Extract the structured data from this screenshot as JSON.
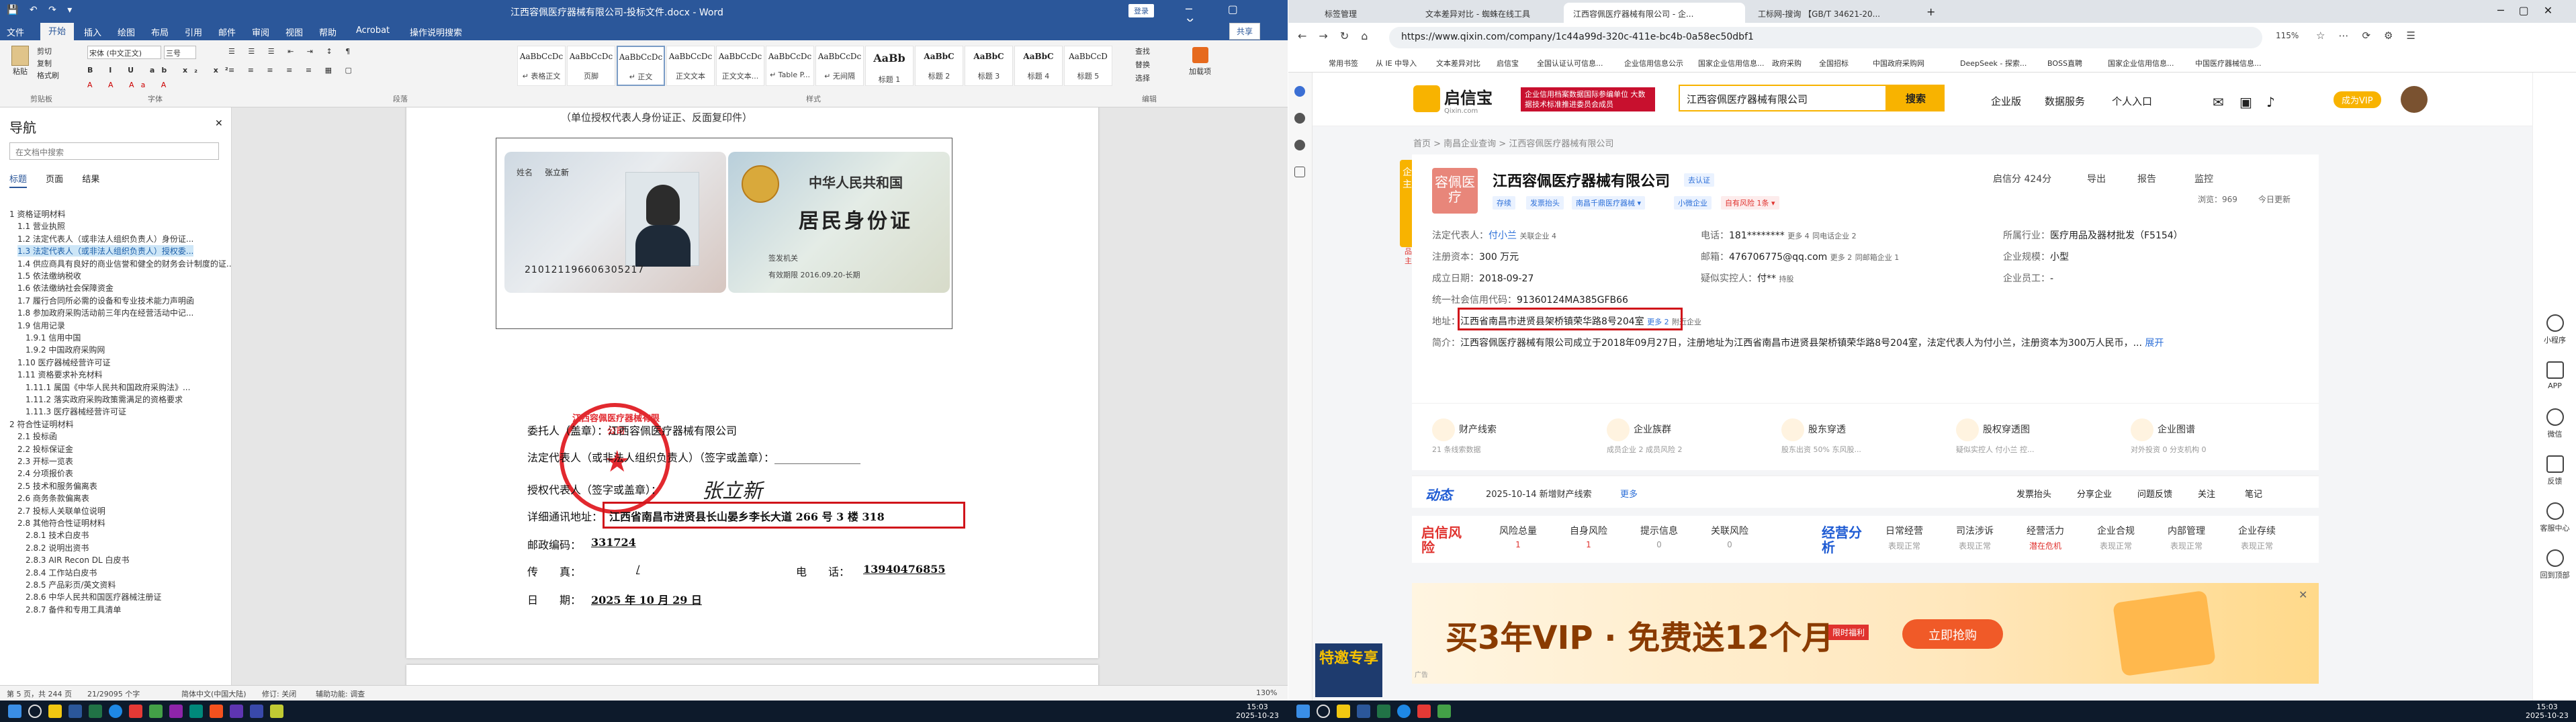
{
  "word": {
    "title": "江西容佩医疗器械有限公司-投标文件.docx - Word",
    "account": "登录",
    "share": "共享",
    "tabs": [
      "文件",
      "开始",
      "插入",
      "绘图",
      "布局",
      "引用",
      "邮件",
      "审阅",
      "视图",
      "帮助",
      "Acrobat",
      "操作说明搜索"
    ],
    "clipboard": {
      "paste": "粘贴",
      "cut": "剪切",
      "copy": "复制",
      "painter": "格式刷",
      "group": "剪贴板"
    },
    "font": {
      "name": "宋体 (中文正文)",
      "size": "三号",
      "group": "字体"
    },
    "paragraph_group": "段落",
    "styles": [
      {
        "sample": "AaBbCcDc",
        "name": "↵ 表格正文"
      },
      {
        "sample": "AaBbCcDc",
        "name": "页脚"
      },
      {
        "sample": "AaBbCcDc",
        "name": "↵ 正文"
      },
      {
        "sample": "AaBbCcDc",
        "name": "正文文本"
      },
      {
        "sample": "AaBbCcDc",
        "name": "正文文本..."
      },
      {
        "sample": "AaBbCcDc",
        "name": "↵ Table P..."
      },
      {
        "sample": "AaBbCcDc",
        "name": "↵ 无间隔"
      },
      {
        "sample": "AaBb",
        "name": "标题 1"
      },
      {
        "sample": "AaBbC",
        "name": "标题 2"
      },
      {
        "sample": "AaBbC",
        "name": "标题 3"
      },
      {
        "sample": "AaBbC",
        "name": "标题 4"
      },
      {
        "sample": "AaBbCcD",
        "name": "标题 5"
      }
    ],
    "styles_group": "样式",
    "editing": {
      "find": "查找",
      "replace": "替换",
      "select": "选择",
      "group": "编辑"
    },
    "addin": "加载项",
    "nav": {
      "title": "导航",
      "search_placeholder": "在文档中搜索",
      "tabs": [
        "标题",
        "页面",
        "结果"
      ],
      "items": [
        "1 资格证明材料",
        "1.1 营业执照",
        "1.2 法定代表人（或非法人组织负责人）身份证...",
        "1.3 法定代表人（或非法人组织负责人）授权委...",
        "1.4 供应商具有良好的商业信誉和健全的财务会计制度的证...",
        "1.5 依法缴纳税收",
        "1.6 依法缴纳社会保障资金",
        "1.7 履行合同所必需的设备和专业技术能力声明函",
        "1.8 参加政府采购活动前三年内在经营活动中记...",
        "1.9 信用记录",
        "1.9.1 信用中国",
        "1.9.2 中国政府采购网",
        "1.10 医疗器械经营许可证",
        "1.11 资格要求补充材料",
        "1.11.1 属国《中华人民共和国政府采购法》...",
        "1.11.2 落实政府采购政策需满足的资格要求",
        "1.11.3 医疗器械经营许可证",
        "2 符合性证明材料",
        "2.1 投标函",
        "2.2 投标保证金",
        "2.3 开标一览表",
        "2.4 分项报价表",
        "2.5 技术和服务偏离表",
        "2.6 商务条款偏离表",
        "2.7 投标人关联单位说明",
        "2.8 其他符合性证明材料",
        "2.8.1 技术白皮书",
        "2.8.2 说明出资书",
        "2.8.3 AIR Recon DL 白皮书",
        "2.8.4 工作站白皮书",
        "2.8.5 产品彩页/英文资料",
        "2.8.6 中华人民共和国医疗器械注册证",
        "2.8.7 备件和专用工具清单"
      ]
    },
    "doc": {
      "header_line": "（单位授权代表人身份证正、反面复印件）",
      "id_front": {
        "title": "姓名",
        "name": "张立新",
        "number": "210121196606305217"
      },
      "id_back": {
        "line1": "中华人民共和国",
        "line2": "居民身份证",
        "authority": "签发机关",
        "validity": "有效期限 2016.09.20-长期"
      },
      "seal_text": "江西容佩医疗器械有限公司",
      "line_client": "委托人（盖章）：江西容佩医疗器械有限公司",
      "line_legal": "法定代表人（或非法人组织负责人）（签字或盖章）：________________",
      "line_agent": "授权代表人（签字或盖章）：",
      "agent_signature": "张立新",
      "line_address_label": "详细通讯地址：",
      "line_address": "江西省南昌市进贤县长山晏乡李长大道 266 号 3 楼 318",
      "line_zip_label": "邮政编码：",
      "zip": "331724",
      "line_fax_label": "传　　真：",
      "fax_val": "/",
      "phone_label": "电　　话：",
      "phone": "13940476855",
      "date_label": "日　　期：",
      "date": "2025 年 10 月 29 日"
    },
    "status": {
      "page": "第 5 页，共 244 页",
      "words": "21/29095 个字",
      "lang": "简体中文(中国大陆)",
      "predict": "修订: 关闭",
      "access": "辅助功能: 调查",
      "zoom": "130%"
    }
  },
  "browser": {
    "tabs": [
      "标签管理",
      "文本差异对比 - 蜘蛛在线工具",
      "江西容佩医疗器械有限公司 - 企...",
      "工标网-搜询 【GB/T 34621-20..."
    ],
    "url": "https://www.qixin.com/company/1c44a99d-320c-411e-bc4b-0a58ec50dbf1",
    "zoom": "115%",
    "bookmarks": [
      "常用书签",
      "从 IE 中导入",
      "文本差异对比",
      "启信宝",
      "全国认证认可信息...",
      "企业信用信息公示",
      "国家企业信用信息...",
      "政府采购",
      "全国招标",
      "中国政府采购网",
      "DeepSeek - 探索...",
      "BOSS直聘",
      "国家企业信用信息...",
      "中国医疗器械信息..."
    ],
    "right_side": [
      "小程序",
      "APP",
      "微信",
      "反馈",
      "客服中心",
      "回到顶部"
    ]
  },
  "qixin": {
    "logo": "启信宝",
    "logo_sub": "Qixin.com",
    "banner": "企业信用档案数据国际参编单位 大数据技术标准推进委员会成员",
    "search_value": "江西容佩医疗器械有限公司",
    "search_btn": "搜索",
    "nav": [
      "企业版",
      "数据服务",
      "个人入口",
      "成为VIP"
    ],
    "breadcrumb": "首页  >  南昌企业查询  >  江西容佩医疗器械有限公司",
    "side_tag": "企业主页",
    "side_tag2": "品牌主页",
    "company": {
      "logo": "容佩医疗",
      "name": "江西容佩医疗器械有限公司",
      "follow": "去认证",
      "score": "启信分 424分",
      "actions": [
        "导出",
        "报告",
        "监控"
      ],
      "views": "浏览：969",
      "updated": "今日更新",
      "tags": [
        "存续",
        "发票抬头",
        "南昌千鼎医疗器械 ▾",
        "小微企业",
        "自有风险 1条 ▾"
      ],
      "legal_label": "法定代表人：",
      "legal": "付小兰",
      "legal_rel": "关联企业 4",
      "phone_label": "电话：",
      "phone": "181********",
      "phone_more": "更多 4",
      "phone_same": "同电话企业 2",
      "industry_label": "所属行业：",
      "industry": "医疗用品及器材批发（F5154）",
      "capital_label": "注册资本：",
      "capital": "300 万元",
      "email_label": "邮箱：",
      "email": "476706775@qq.com",
      "email_more": "更多 2",
      "email_same": "同邮箱企业 1",
      "scale_label": "企业规模：",
      "scale": "小型",
      "founded_label": "成立日期：",
      "founded": "2018-09-27",
      "controller_label": "疑似实控人：",
      "controller": "付**",
      "controller_pct": "持股",
      "staff_label": "企业员工：",
      "staff": "-",
      "credit_label": "统一社会信用代码：",
      "credit": "91360124MA385GFB66",
      "address_label": "地址：",
      "address": "江西省南昌市进贤县架桥镇荣华路8号204室",
      "address_more": "更多 2",
      "address_near": "附近企业",
      "intro_label": "简介：",
      "intro": "江西容佩医疗器械有限公司成立于2018年09月27日，注册地址为江西省南昌市进贤县架桥镇荣华路8号204室，法定代表人为付小兰，注册资本为300万人民币，...",
      "intro_more": "展开",
      "risk": [
        {
          "t": "财产线索",
          "s": "21 条线索数据"
        },
        {
          "t": "企业族群",
          "s": "成员企业 2 成员风险 2"
        },
        {
          "t": "股东穿透",
          "s": "股东出资 50% 东风股..."
        },
        {
          "t": "股权穿透图",
          "s": "疑似实控人 付小兰 控..."
        },
        {
          "t": "企业图谱",
          "s": "对外投资 0 分支机构 0"
        }
      ]
    },
    "dynamic": {
      "label": "动态",
      "text": "2025-10-14 新增财产线索",
      "more": "更多",
      "actions": [
        "发票抬头",
        "分享企业",
        "问题反馈",
        "关注",
        "笔记"
      ]
    },
    "modules": {
      "left_label": "启信风险",
      "left": [
        {
          "t": "风险总量",
          "v": "1"
        },
        {
          "t": "自身风险",
          "v": "1"
        },
        {
          "t": "提示信息",
          "v": "0"
        },
        {
          "t": "关联风险",
          "v": "0"
        }
      ],
      "right_label": "经营分析",
      "right": [
        {
          "t": "日常经营",
          "v": "表现正常"
        },
        {
          "t": "司法涉诉",
          "v": "表现正常"
        },
        {
          "t": "经营活力",
          "v": "潜在危机"
        },
        {
          "t": "企业合规",
          "v": "表现正常"
        },
        {
          "t": "内部管理",
          "v": "表现正常"
        },
        {
          "t": "企业存续",
          "v": "表现正常"
        }
      ]
    },
    "ad": {
      "text": "买3年VIP · 免费送12个月",
      "badge": "限时福利",
      "button": "立即抢购",
      "tag": "广告"
    },
    "special": "特邀专享"
  },
  "taskbar": {
    "clock_left": "15:03",
    "date_left": "2025-10-23",
    "clock_right": "15:03",
    "date_right": "2025-10-23"
  },
  "colors": {
    "word_blue": "#2b579a",
    "highlight_red": "#d0141a",
    "qixin_yellow": "#f8b300",
    "taskbar": "#0d1a2b"
  }
}
